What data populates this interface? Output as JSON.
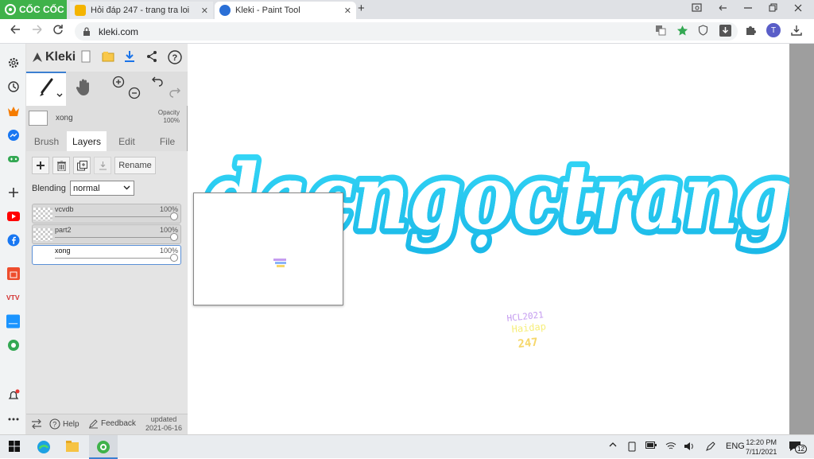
{
  "browser": {
    "brand": "CỐC CỐC",
    "tabs": [
      {
        "title": "Hỏi đáp 247 - trang tra loi",
        "active": false
      },
      {
        "title": "Kleki - Paint Tool",
        "active": true
      }
    ],
    "url": "kleki.com",
    "profile_initial": "T"
  },
  "kleki": {
    "logo": "Kleki",
    "layer_name": "xong",
    "opacity_label": "Opacity",
    "opacity_value": "100%",
    "tabs": [
      "Brush",
      "Layers",
      "Edit",
      "File"
    ],
    "active_tab": "Layers",
    "rename_label": "Rename",
    "blending_label": "Blending",
    "blending_value": "normal",
    "layers": [
      {
        "name": "vcvdb",
        "opacity": "100%",
        "selected": false
      },
      {
        "name": "part2",
        "opacity": "100%",
        "selected": false
      },
      {
        "name": "xong",
        "opacity": "100%",
        "selected": true
      }
    ],
    "footer": {
      "help": "Help",
      "feedback": "Feedback",
      "updated_label": "updated",
      "updated_date": "2021-06-16"
    }
  },
  "canvas": {
    "drawing_text": "dacngọctrang",
    "small_text_lines": [
      "HCL2021",
      "Haidap",
      "247"
    ]
  },
  "taskbar": {
    "language": "ENG",
    "time": "12:20 PM",
    "date": "7/11/2021",
    "notifications": "12"
  },
  "colors": {
    "accent": "#3b7fd1",
    "drawing_cyan": "#22ccf0",
    "browser_green": "#3fb24a"
  }
}
